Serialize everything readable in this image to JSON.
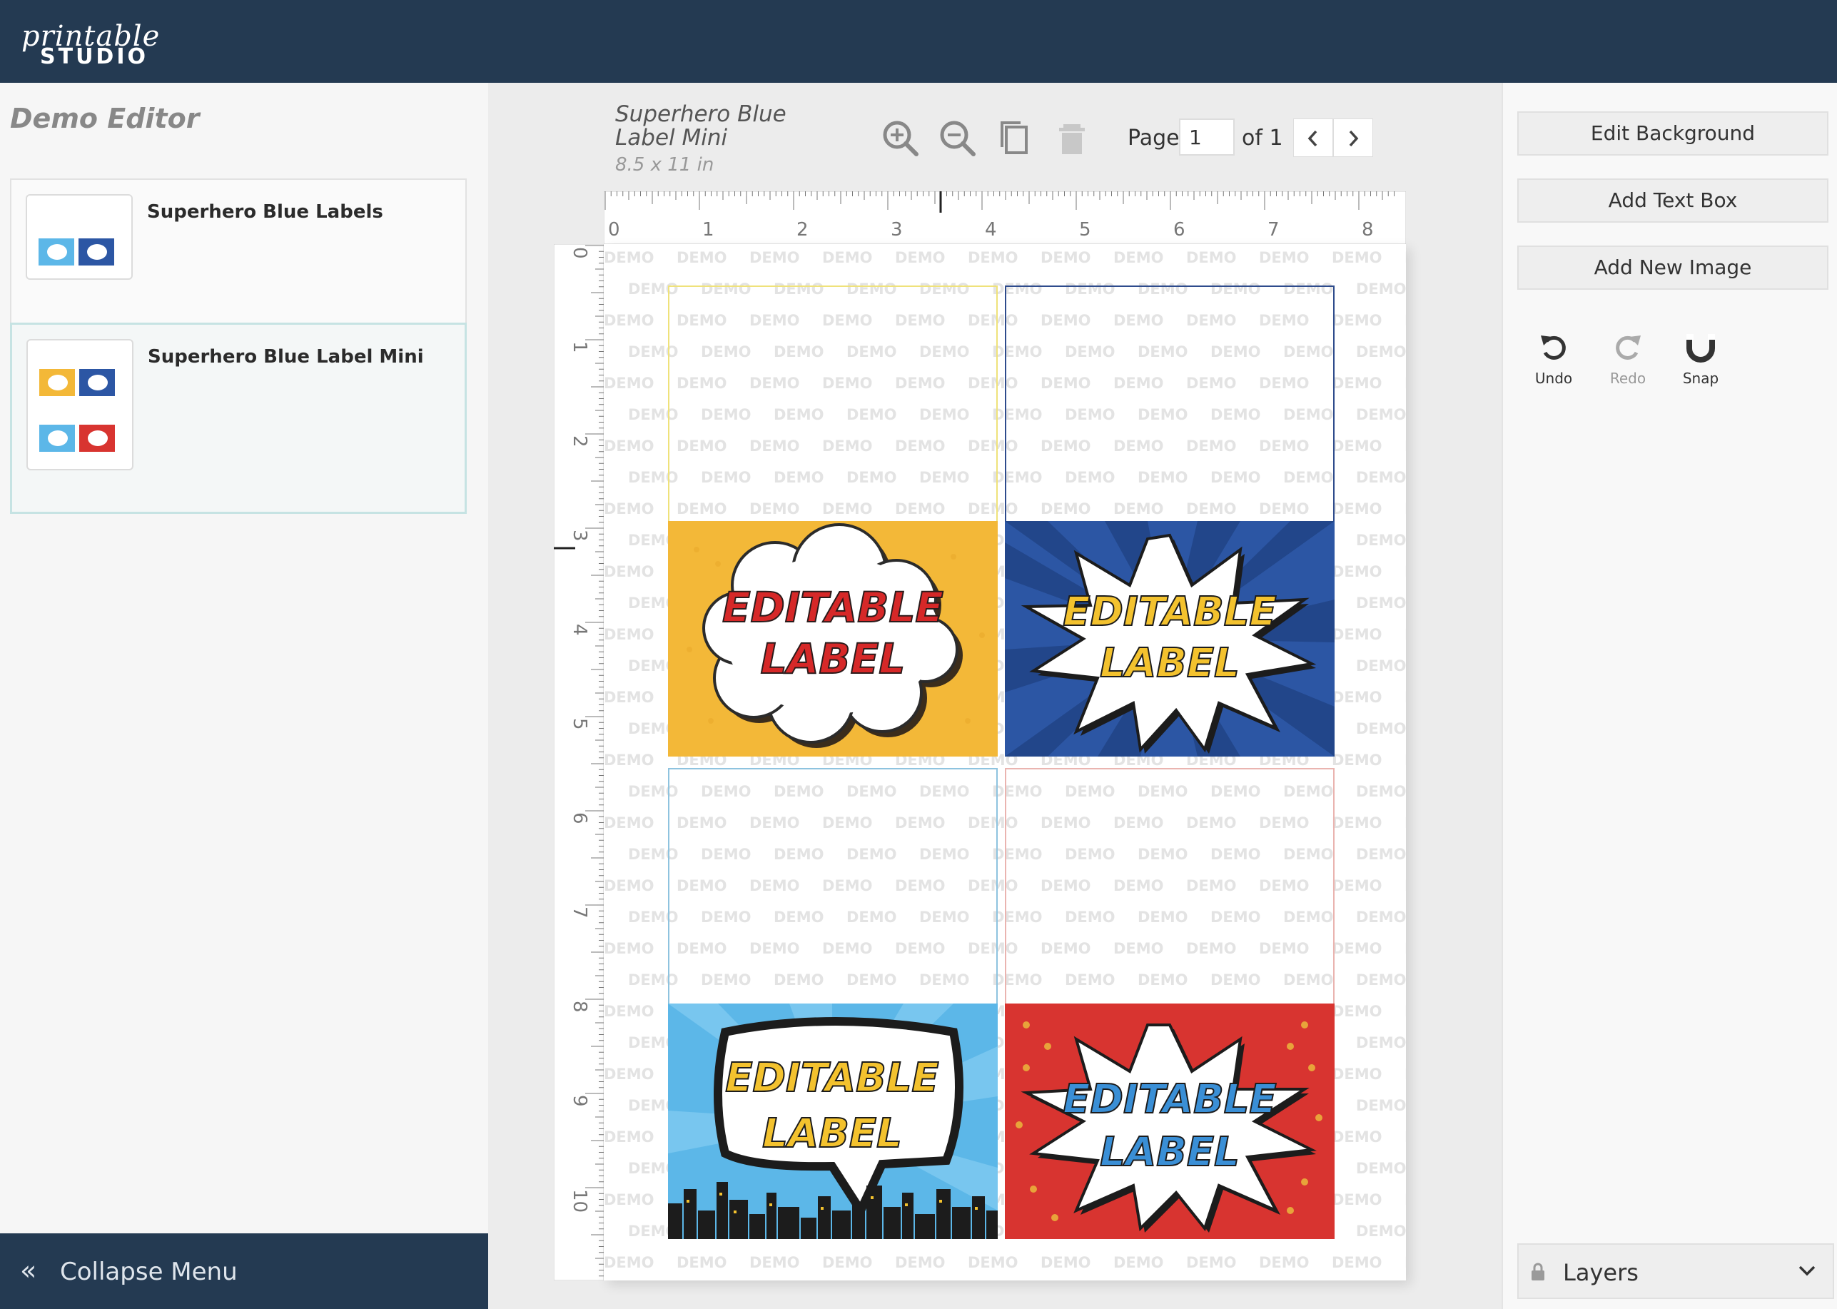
{
  "brand": {
    "script": "printable",
    "studio": "STUDIO"
  },
  "left_panel": {
    "title": "Demo Editor",
    "templates": [
      {
        "name": "Superhero Blue Labels"
      },
      {
        "name": "Superhero Blue Label Mini"
      }
    ],
    "collapse_label": "Collapse Menu"
  },
  "document": {
    "title": "Superhero Blue Label Mini",
    "size": "8.5 x 11 in"
  },
  "toolbar": {
    "icons": [
      "zoom-in-icon",
      "zoom-out-icon",
      "copy-icon",
      "trash-icon"
    ],
    "page_label": "Page",
    "page_value": "1",
    "page_of": "of 1"
  },
  "ruler": {
    "horizontal_ticks": [
      "0",
      "1",
      "2",
      "3",
      "4",
      "5",
      "6",
      "7",
      "8"
    ],
    "vertical_ticks": [
      "0",
      "1",
      "2",
      "3",
      "4",
      "5",
      "6",
      "7",
      "8",
      "9",
      "10"
    ]
  },
  "canvas": {
    "watermark_text": "DEMO",
    "labels": [
      {
        "line1": "EDITABLE",
        "line2": "LABEL",
        "style": "cloud",
        "bg": "#f3b838",
        "text_color": "#d62828",
        "border": "#efe27a"
      },
      {
        "line1": "EDITABLE",
        "line2": "LABEL",
        "style": "burst",
        "bg": "#2c56a4",
        "text_color": "#f3c22e",
        "border": "#2e4b8c"
      },
      {
        "line1": "EDITABLE",
        "line2": "LABEL",
        "style": "speech",
        "bg": "#5cb7e8",
        "text_color": "#f3c22e",
        "border": "#8ec3df"
      },
      {
        "line1": "EDITABLE",
        "line2": "LABEL",
        "style": "burst",
        "bg": "#d83430",
        "text_color": "#3a8fd6",
        "border": "#eab4b0"
      }
    ]
  },
  "right_panel": {
    "buttons": [
      "Edit Background",
      "Add Text Box",
      "Add New Image"
    ],
    "tools": [
      {
        "label": "Undo",
        "icon": "undo-icon"
      },
      {
        "label": "Redo",
        "icon": "redo-icon"
      },
      {
        "label": "Snap",
        "icon": "magnet-icon"
      }
    ],
    "layers_label": "Layers"
  },
  "colors": {
    "header": "#243a52",
    "active_border": "#c6e3e3"
  }
}
